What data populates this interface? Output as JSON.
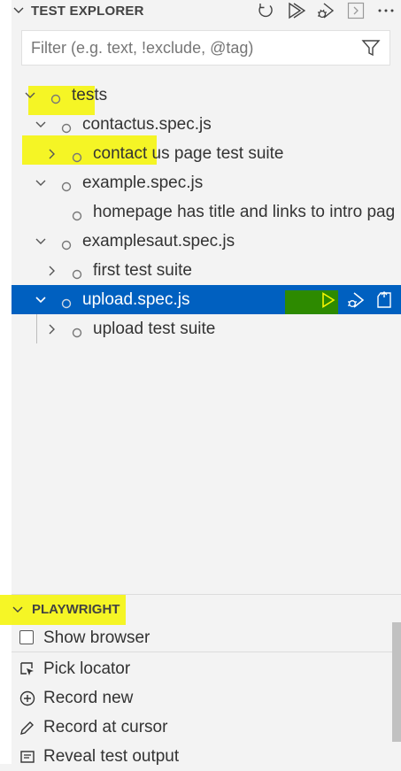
{
  "header": {
    "title": "TEST EXPLORER",
    "actions": [
      "refresh-icon",
      "run-all-icon",
      "debug-all-icon",
      "output-icon",
      "more-icon"
    ]
  },
  "filter": {
    "placeholder": "Filter (e.g. text, !exclude, @tag)",
    "value": ""
  },
  "tree": {
    "items": [
      {
        "label": "tests",
        "expanded": true
      },
      {
        "label": "contactus.spec.js",
        "expanded": true
      },
      {
        "label": "contact us page test suite",
        "expanded": false
      },
      {
        "label": "example.spec.js",
        "expanded": true
      },
      {
        "label": "homepage has title and links to intro pag"
      },
      {
        "label": "examplesaut.spec.js",
        "expanded": true
      },
      {
        "label": "first test suite",
        "expanded": false
      },
      {
        "label": "upload.spec.js",
        "expanded": true,
        "selected": true
      },
      {
        "label": "upload test suite",
        "expanded": false
      }
    ],
    "selected_row_actions": [
      "run-test-icon",
      "debug-test-icon",
      "go-to-test-icon"
    ]
  },
  "playwright": {
    "title": "PLAYWRIGHT",
    "show_browser": {
      "label": "Show browser",
      "checked": false
    },
    "actions": [
      {
        "label": "Pick locator",
        "icon": "pick-locator-icon"
      },
      {
        "label": "Record new",
        "icon": "record-new-icon"
      },
      {
        "label": "Record at cursor",
        "icon": "pencil-icon"
      },
      {
        "label": "Reveal test output",
        "icon": "output-icon"
      }
    ]
  },
  "colors": {
    "selection": "#0060c0",
    "highlight": "#f5f500",
    "background": "#f3f3f3"
  }
}
